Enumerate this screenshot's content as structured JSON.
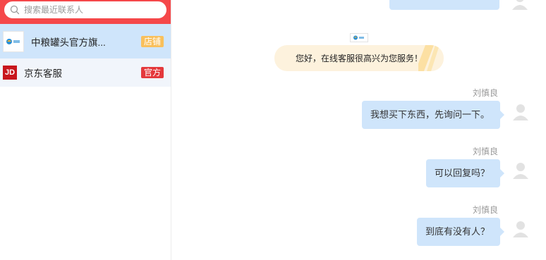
{
  "search": {
    "placeholder": "搜索最近联系人"
  },
  "contacts": [
    {
      "name": "中粮罐头官方旗...",
      "badge": "店铺",
      "badge_color": "#f9c05c"
    },
    {
      "name": "京东客服",
      "avatar_text": "JD",
      "badge": "官方",
      "badge_color": "#e4393c"
    }
  ],
  "chat": {
    "welcome_text": "您好，在线客服很高兴为您服务！",
    "messages": [
      {
        "sender": "刘慎良",
        "text": "我想买下东西，先询问一下。"
      },
      {
        "sender": "刘慎良",
        "text": "可以回复吗？"
      },
      {
        "sender": "刘慎良",
        "text": "到底有没有人？"
      }
    ]
  },
  "colors": {
    "header": "#f5484a",
    "bubble": "#cfe5fb",
    "active_contact": "#cfe5fb",
    "welcome_bg": "#fdf2dd"
  }
}
